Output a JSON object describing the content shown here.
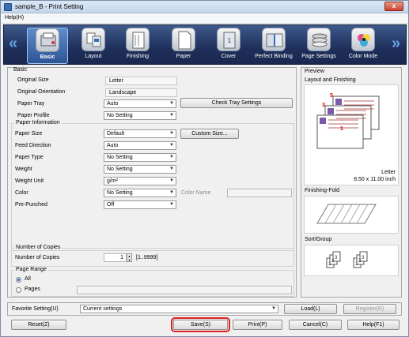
{
  "window": {
    "title": "sample_B - Print Setting",
    "close_label": "x"
  },
  "menu": {
    "help": "Help(H)"
  },
  "toolbar": {
    "left_arrow": "«",
    "right_arrow": "»",
    "items": [
      {
        "label": "Basic",
        "icon": "basic-icon"
      },
      {
        "label": "Layout",
        "icon": "layout-icon"
      },
      {
        "label": "Finishing",
        "icon": "finishing-icon"
      },
      {
        "label": "Paper",
        "icon": "paper-icon"
      },
      {
        "label": "Cover",
        "icon": "cover-icon"
      },
      {
        "label": "Perfect Binding",
        "icon": "perfect-binding-icon"
      },
      {
        "label": "Page Settings",
        "icon": "page-settings-icon"
      },
      {
        "label": "Color Mode",
        "icon": "color-mode-icon"
      }
    ],
    "active": "Basic"
  },
  "basic": {
    "title": "Basic",
    "original_size_label": "Original Size",
    "original_size_value": "Letter",
    "original_orientation_label": "Original Orientation",
    "original_orientation_value": "Landscape",
    "paper_tray_label": "Paper Tray",
    "paper_tray_value": "Auto",
    "check_tray_button": "Check Tray Settings",
    "paper_profile_label": "Paper Profile",
    "paper_profile_value": "No Setting",
    "paper_info": {
      "title": "Paper Information",
      "paper_size_label": "Paper Size",
      "paper_size_value": "Default",
      "custom_size_button": "Custom Size...",
      "feed_direction_label": "Feed Direction",
      "feed_direction_value": "Auto",
      "paper_type_label": "Paper Type",
      "paper_type_value": "No Setting",
      "weight_label": "Weight",
      "weight_value": "No Setting",
      "weight_unit_label": "Weight Unit",
      "weight_unit_value": "g/m²",
      "color_label": "Color",
      "color_value": "No Setting",
      "color_name_label": "Color Name",
      "pre_punched_label": "Pre-Punched",
      "pre_punched_value": "Off"
    },
    "copies": {
      "title": "Number of Copies",
      "label": "Number of Copies",
      "value": "1",
      "range": "[1..9999]"
    },
    "page_range": {
      "title": "Page Range",
      "all_label": "All",
      "pages_label": "Pages",
      "selected": "All"
    }
  },
  "preview": {
    "title": "Preview",
    "layout_label": "Layout and Finishing",
    "paper_name": "Letter",
    "paper_dims": "8.50 x 11.00 inch",
    "finishing_fold_label": "Finishing-Fold",
    "sort_group_label": "Sort/Group",
    "page_numbers": [
      "5",
      "3",
      "1"
    ]
  },
  "favorite": {
    "label": "Favorite Setting(U)",
    "value": "Current settings",
    "load_button": "Load(L)",
    "register_button": "Register(R)"
  },
  "bottom": {
    "reset_button": "Reset(Z)",
    "save_button": "Save(S)",
    "print_button": "Print(P)",
    "cancel_button": "Cancel(C)",
    "help_button": "Help(F1)"
  },
  "colors": {
    "toolbar_bg": "#1e2f5a",
    "highlight": "#e02020",
    "active_tab": "#5d8ccc"
  }
}
